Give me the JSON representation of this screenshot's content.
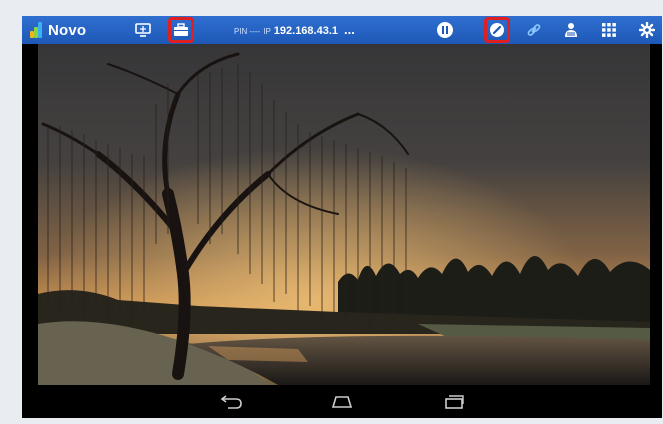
{
  "app": {
    "name": "Novo"
  },
  "connection": {
    "pin_label": "PIN ----",
    "ip_label": "IP",
    "ip_value": "192.168.43.1",
    "more": "..."
  },
  "toolbar": {
    "icons": [
      "screen-mirror-icon",
      "briefcase-icon",
      "pause-icon",
      "annotate-icon",
      "link-icon",
      "users-icon",
      "grid-icon",
      "settings-icon"
    ],
    "highlighted": [
      "briefcase-icon",
      "annotate-icon"
    ],
    "highlight_color": "#e02020",
    "bar_color": "#1e58b6"
  },
  "content": {
    "description_image": "sunset-willow-tree-lake-photo"
  },
  "android_nav": {
    "buttons": [
      "back-icon",
      "home-icon",
      "recents-icon"
    ]
  }
}
